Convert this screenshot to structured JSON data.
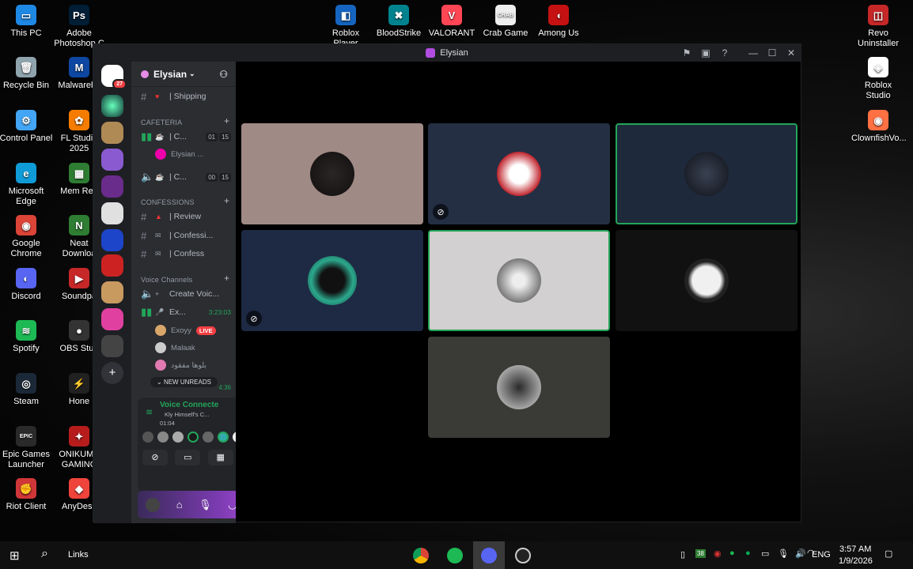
{
  "desktop": {
    "left_icons": [
      {
        "label": "This PC",
        "glyph": "▭",
        "color": "#1e88e5"
      },
      {
        "label": "Recycle Bin",
        "glyph": "🗑",
        "color": "#90a4ae"
      },
      {
        "label": "Control Panel",
        "glyph": "⚙",
        "color": "#42a5f5"
      },
      {
        "label": "Microsoft Edge",
        "glyph": "e",
        "color": "#0f9bd7"
      },
      {
        "label": "Google Chrome",
        "glyph": "◉",
        "color": "#db4437"
      },
      {
        "label": "Discord",
        "glyph": "◐",
        "color": "#5865f2"
      },
      {
        "label": "Spotify",
        "glyph": "≋",
        "color": "#1db954"
      },
      {
        "label": "Steam",
        "glyph": "◎",
        "color": "#1b2838"
      },
      {
        "label": "Epic Games Launcher",
        "glyph": "EPIC",
        "color": "#2a2a2a"
      },
      {
        "label": "Riot Client",
        "glyph": "✊",
        "color": "#d13639"
      }
    ],
    "second_icons": [
      {
        "label": "Adobe Photoshop C",
        "glyph": "Ps",
        "color": "#001e36"
      },
      {
        "label": "Malwareby",
        "glyph": "M",
        "color": "#0d47a1"
      },
      {
        "label": "FL Studio 2025",
        "glyph": "✿",
        "color": "#f57c00"
      },
      {
        "label": "Mem Red",
        "glyph": "▦",
        "color": "#2e7d32"
      },
      {
        "label": "Neat Downloa",
        "glyph": "N",
        "color": "#2e7d32"
      },
      {
        "label": "Soundpa",
        "glyph": "▶",
        "color": "#c62828"
      },
      {
        "label": "OBS Stud",
        "glyph": "●",
        "color": "#333333"
      },
      {
        "label": "Hone",
        "glyph": "⚡",
        "color": "#212121"
      },
      {
        "label": "ONIKUMA GAMING",
        "glyph": "✦",
        "color": "#b71c1c"
      },
      {
        "label": "AnyDesk",
        "glyph": "◆",
        "color": "#ef443b"
      }
    ],
    "top_icons": [
      {
        "label": "Roblox Player",
        "glyph": "◧",
        "color": "#1565c0"
      },
      {
        "label": "BloodStrike",
        "glyph": "✖",
        "color": "#00838f"
      },
      {
        "label": "VALORANT",
        "glyph": "V",
        "color": "#ff4655"
      },
      {
        "label": "Crab Game",
        "glyph": "CRAB",
        "color": "#eeeeee"
      },
      {
        "label": "Among Us",
        "glyph": "◖",
        "color": "#c51111"
      }
    ],
    "right_icons": [
      {
        "label": "Revo Uninstaller",
        "glyph": "◫",
        "color": "#c62828"
      },
      {
        "label": "Roblox Studio",
        "glyph": "◈",
        "color": "#ffffff"
      },
      {
        "label": "ClownfishVo...",
        "glyph": "◉",
        "color": "#ff7043"
      }
    ]
  },
  "discord": {
    "title": "Elysian",
    "server_mention_badge": "27",
    "guild_name": "Elysian",
    "channels": {
      "shipping": "| Shipping",
      "cat_cafeteria": "CAFETERIA",
      "cafe1_name": "| C...",
      "cafe1_count": "01",
      "cafe1_limit": "15",
      "cafe1_user": "Elysian ...",
      "cafe2_name": "| C...",
      "cafe2_count": "00",
      "cafe2_limit": "15",
      "cat_confessions": "CONFESSIONS",
      "review": "| Review",
      "confessi": "| Confessi...",
      "confess": "| Confess",
      "cat_voice": "Voice Channels",
      "create_voice": "Create Voic...",
      "ex_channel": "Ex...",
      "ex_timer": "3:23:03",
      "user1": "Exoyy",
      "user1_live": "LIVE",
      "user2": "Malaak",
      "user3": "بلوها مفقود",
      "new_unreads": "NEW UNREADS",
      "partial_timer": "4:36"
    },
    "voice_panel": {
      "status": "Voice Connecte",
      "channel": "Kly Himself's C...",
      "timer": "01:04"
    }
  },
  "taskbar": {
    "search_label": "Links",
    "tray_badge": "38",
    "lang": "ENG",
    "time": "3:57 AM",
    "date": "1/9/2026"
  }
}
